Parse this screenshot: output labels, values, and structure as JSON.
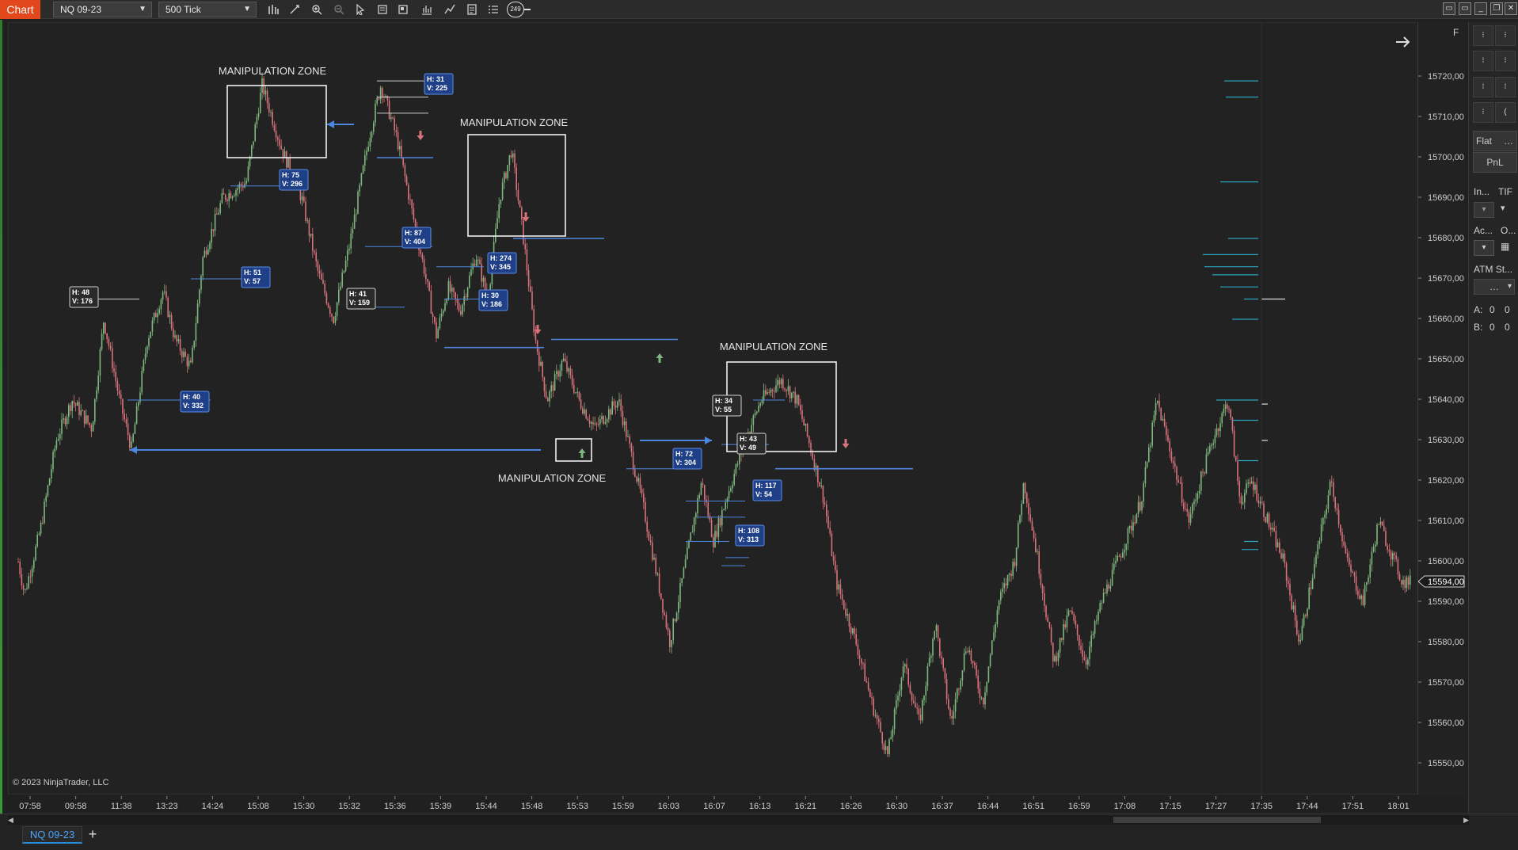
{
  "toolbar": {
    "chart_label": "Chart",
    "instrument": "NQ 09-23",
    "interval": "500 Tick",
    "badge": "249"
  },
  "chart": {
    "copyright": "© 2023 NinjaTrader, LLC",
    "current_price": "15594,00",
    "price_ticks": [
      "15720,00",
      "15710,00",
      "15700,00",
      "15690,00",
      "15680,00",
      "15670,00",
      "15660,00",
      "15650,00",
      "15640,00",
      "15630,00",
      "15620,00",
      "15610,00",
      "15600,00",
      "15590,00",
      "15580,00",
      "15570,00",
      "15560,00",
      "15550,00"
    ],
    "time_ticks": [
      "07:58",
      "09:58",
      "11:38",
      "13:23",
      "14:24",
      "15:08",
      "15:30",
      "15:32",
      "15:36",
      "15:39",
      "15:44",
      "15:48",
      "15:53",
      "15:59",
      "16:03",
      "16:07",
      "16:13",
      "16:21",
      "16:26",
      "16:30",
      "16:37",
      "16:44",
      "16:51",
      "16:59",
      "17:08",
      "17:15",
      "17:27",
      "17:35",
      "17:44",
      "17:51",
      "18:01"
    ],
    "zone_label": "MANIPULATION ZONE",
    "labels": [
      {
        "h": "H: 48",
        "v": "V: 176",
        "style": "white"
      },
      {
        "h": "H: 40",
        "v": "V: 332",
        "style": "blue"
      },
      {
        "h": "H: 51",
        "v": "V: 57",
        "style": "blue"
      },
      {
        "h": "H: 75",
        "v": "V: 296",
        "style": "blue"
      },
      {
        "h": "H: 31",
        "v": "V: 225",
        "style": "blue"
      },
      {
        "h": "H: 87",
        "v": "V: 404",
        "style": "blue"
      },
      {
        "h": "H: 41",
        "v": "V: 159",
        "style": "white"
      },
      {
        "h": "H: 274",
        "v": "V: 345",
        "style": "blue"
      },
      {
        "h": "H: 30",
        "v": "V: 186",
        "style": "blue"
      },
      {
        "h": "H: 72",
        "v": "V: 304",
        "style": "blue"
      },
      {
        "h": "H: 34",
        "v": "V: 55",
        "style": "white"
      },
      {
        "h": "H: 43",
        "v": "V: 49",
        "style": "white"
      },
      {
        "h": "H: 117",
        "v": "V: 54",
        "style": "blue"
      },
      {
        "h": "H: 108",
        "v": "V: 313",
        "style": "blue"
      }
    ]
  },
  "right_panel": {
    "flat": "Flat",
    "pnl": "PnL",
    "instrument_short": "In...",
    "tif": "TIF",
    "account_short": "Ac...",
    "order_short": "O...",
    "atm": "ATM St...",
    "a_label": "A:",
    "a_val1": "0",
    "a_val2": "0",
    "b_label": "B:",
    "b_val1": "0",
    "b_val2": "0",
    "f_label": "F"
  },
  "bottom": {
    "tab": "NQ 09-23",
    "add": "+"
  },
  "colors": {
    "accent": "#e2481b",
    "up": "#7fb87f",
    "down": "#d9737b",
    "blue_line": "#4d86e0",
    "tab_blue": "#4da3ff"
  }
}
